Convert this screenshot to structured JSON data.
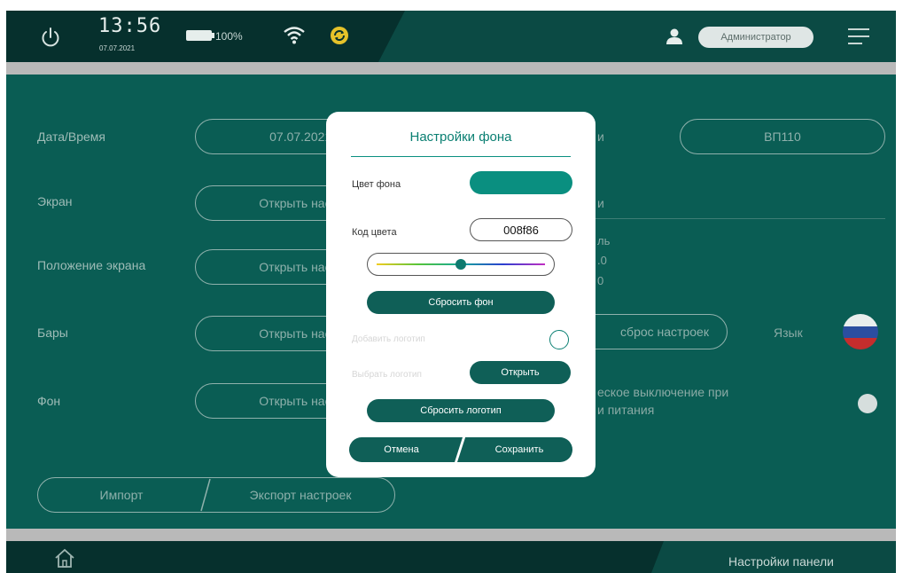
{
  "status": {
    "time": "13:56",
    "date": "07.07.2021",
    "battery": "100%",
    "user_role": "Администратор"
  },
  "settings": {
    "datetime_label": "Дата/Время",
    "datetime_value": "07.07.2021 1",
    "screen_label": "Экран",
    "screen_btn": "Открыть настр",
    "position_label": "Положение экрана",
    "position_btn": "Открыть настр",
    "bars_label": "Бары",
    "bars_btn": "Открыть настр",
    "bg_label": "Фон",
    "bg_btn": "Открыть настр",
    "device_label_fragment": "и",
    "device_value": "ВП110",
    "info_frag_1": "ль",
    "info_frag_2": ".0",
    "info_frag_3": "0",
    "reset_btn": "сброс настроек",
    "language_label": "Язык",
    "autooff_line1": "еское выключение при",
    "autooff_line2": "и питания",
    "import_btn": "Импорт",
    "export_btn": "Экспорт настроек"
  },
  "bottom": {
    "title": "Настройки панели"
  },
  "dialog": {
    "title": "Настройки фона",
    "bg_color_label": "Цвет фона",
    "bg_color_value": "#0a8f80",
    "color_code_label": "Код цвета",
    "color_code_value": "008f86",
    "hue_position": 0.5,
    "reset_bg": "Сбросить фон",
    "add_logo_label": "Добавить логотип",
    "select_logo_label": "Выбрать логотип",
    "open_btn": "Открыть",
    "reset_logo": "Сбросить логотип",
    "cancel_btn": "Отмена",
    "save_btn": "Сохранить"
  },
  "colors": {
    "accent": "#0a8f80",
    "dark": "#06302d",
    "content": "#0a5d54"
  },
  "icons": [
    "power-icon",
    "battery-icon",
    "wifi-icon",
    "sync-icon",
    "user-icon",
    "menu-icon",
    "home-icon",
    "flag-russia-icon"
  ]
}
